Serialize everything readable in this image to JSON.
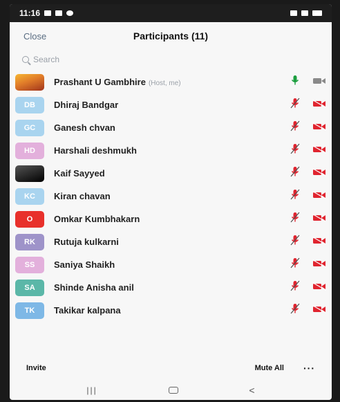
{
  "status_bar": {
    "time": "11:16"
  },
  "header": {
    "close_label": "Close",
    "title": "Participants (11)"
  },
  "search": {
    "placeholder": "Search"
  },
  "participants": [
    {
      "name": "Prashant U Gambhire",
      "tag": "(Host, me)",
      "initials": "",
      "avatar_color": "photo",
      "mic": "on",
      "video": "on"
    },
    {
      "name": "Dhiraj Bandgar",
      "tag": "",
      "initials": "DB",
      "avatar_color": "#a9d4ef",
      "mic": "muted",
      "video": "off"
    },
    {
      "name": "Ganesh chvan",
      "tag": "",
      "initials": "GC",
      "avatar_color": "#a9d4ef",
      "mic": "muted",
      "video": "off"
    },
    {
      "name": "Harshali deshmukh",
      "tag": "",
      "initials": "HD",
      "avatar_color": "#e3b0dc",
      "mic": "muted",
      "video": "off"
    },
    {
      "name": "Kaif Sayyed",
      "tag": "",
      "initials": "",
      "avatar_color": "dark",
      "mic": "muted",
      "video": "off"
    },
    {
      "name": "Kiran chavan",
      "tag": "",
      "initials": "KC",
      "avatar_color": "#a9d4ef",
      "mic": "muted",
      "video": "off"
    },
    {
      "name": "Omkar Kumbhakarn",
      "tag": "",
      "initials": "O",
      "avatar_color": "#e8302b",
      "mic": "muted",
      "video": "off"
    },
    {
      "name": "Rutuja kulkarni",
      "tag": "",
      "initials": "RK",
      "avatar_color": "#9e93c9",
      "mic": "muted",
      "video": "off"
    },
    {
      "name": "Saniya Shaikh",
      "tag": "",
      "initials": "SS",
      "avatar_color": "#e3b0dc",
      "mic": "muted",
      "video": "off"
    },
    {
      "name": "Shinde Anisha anil",
      "tag": "",
      "initials": "SA",
      "avatar_color": "#5bb7a8",
      "mic": "muted",
      "video": "off"
    },
    {
      "name": "Takikar kalpana",
      "tag": "",
      "initials": "TK",
      "avatar_color": "#7eb8e6",
      "mic": "muted",
      "video": "off"
    }
  ],
  "footer": {
    "invite_label": "Invite",
    "mute_all_label": "Mute All",
    "more_label": "···"
  },
  "colors": {
    "mic_on": "#1b9e3e",
    "muted": "#e0242f",
    "video_on": "#8a8a8a",
    "link": "#5a6d82"
  },
  "icons": {
    "mic": "microphone-icon",
    "video": "video-camera-icon",
    "search": "search-icon"
  }
}
